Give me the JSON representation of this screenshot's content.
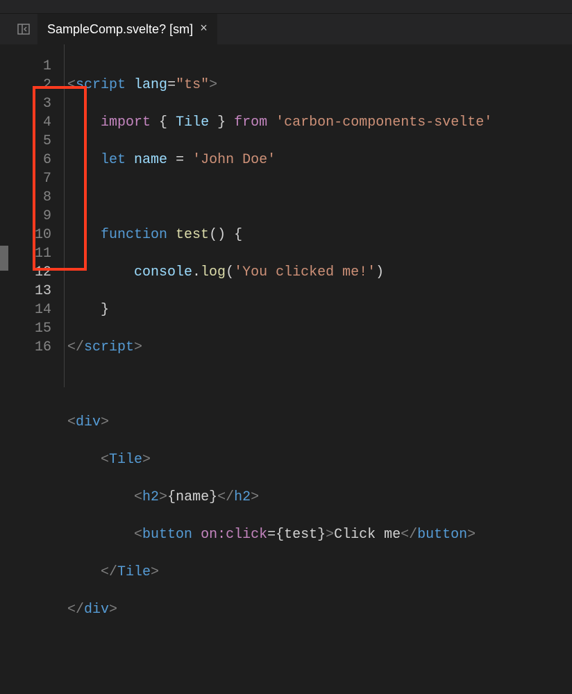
{
  "tab": {
    "label": "SampleComp.svelte? [sm]",
    "close": "×"
  },
  "lineNumbers": [
    "1",
    "2",
    "3",
    "4",
    "5",
    "6",
    "7",
    "8",
    "9",
    "10",
    "11",
    "12",
    "13",
    "14",
    "15",
    "16"
  ],
  "currentLines": [
    12,
    13
  ],
  "code": {
    "l1": {
      "script": "script",
      "lang_attr": "lang",
      "lang_val": "\"ts\""
    },
    "l2": {
      "import": "import",
      "tile": "Tile",
      "from": "from",
      "module": "'carbon-components-svelte'"
    },
    "l3": {
      "let": "let",
      "name": "name",
      "eq": "=",
      "val": "'John Doe'"
    },
    "l5": {
      "func_kw": "function",
      "test": "test",
      "parens": "()",
      "brace": "{"
    },
    "l6": {
      "console": "console",
      "log": "log",
      "msg": "'You clicked me!'"
    },
    "l7": {
      "brace": "}"
    },
    "l8": {
      "script": "script"
    },
    "l10": {
      "div": "div"
    },
    "l11": {
      "tile": "Tile"
    },
    "l12": {
      "h2": "h2",
      "name_expr": "{name}"
    },
    "l13": {
      "button": "button",
      "on_click": "on:click",
      "test_expr": "{test}",
      "text": "Click me"
    },
    "l14": {
      "tile": "Tile"
    },
    "l15": {
      "div": "div"
    }
  }
}
